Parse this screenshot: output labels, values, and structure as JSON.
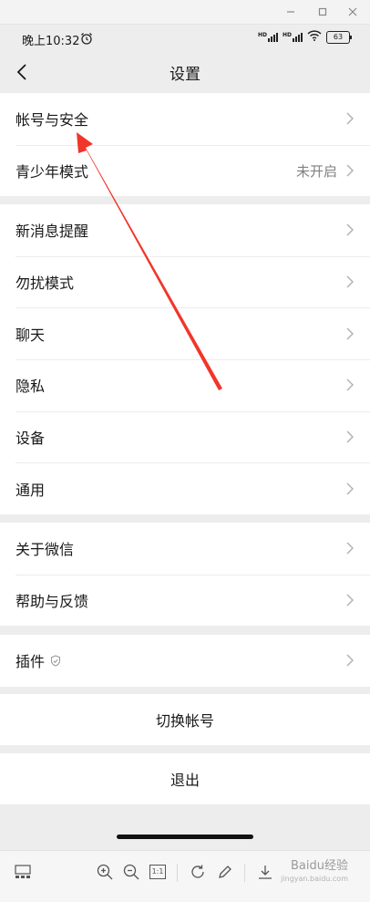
{
  "status": {
    "time": "晚上10:32",
    "battery": "63",
    "hd1": "HD",
    "hd2": "HD"
  },
  "nav": {
    "title": "设置"
  },
  "groups": [
    [
      {
        "label": "帐号与安全"
      },
      {
        "label": "青少年模式",
        "value": "未开启"
      }
    ],
    [
      {
        "label": "新消息提醒"
      },
      {
        "label": "勿扰模式"
      },
      {
        "label": "聊天"
      },
      {
        "label": "隐私"
      },
      {
        "label": "设备"
      },
      {
        "label": "通用"
      }
    ],
    [
      {
        "label": "关于微信"
      },
      {
        "label": "帮助与反馈"
      }
    ],
    [
      {
        "label": "插件"
      }
    ]
  ],
  "actions": {
    "switch_account": "切换帐号",
    "logout": "退出"
  },
  "toolbar": {
    "zoom_reset": "1:1"
  },
  "watermark": {
    "text": "Baidu经验",
    "sub": "jingyan.baidu.com"
  },
  "colors": {
    "annotation_arrow": "#f2352a",
    "background": "#ededed"
  }
}
